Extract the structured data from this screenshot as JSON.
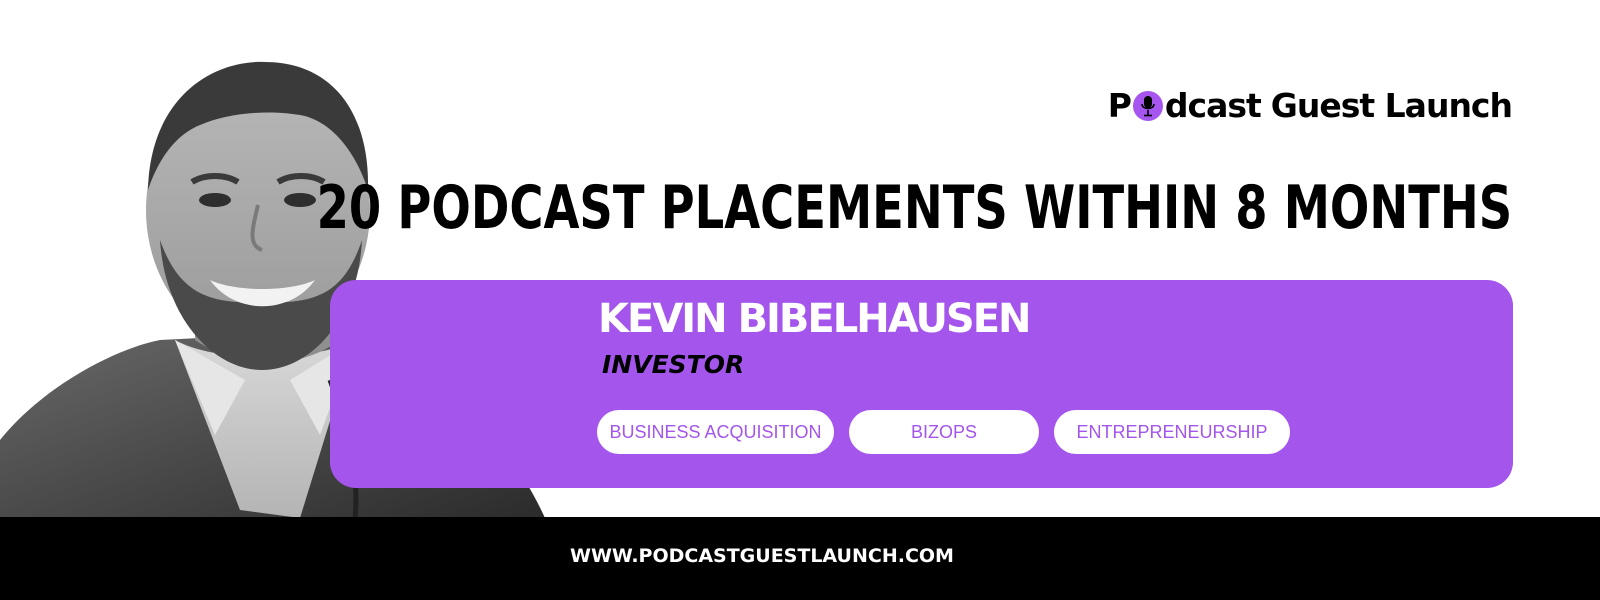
{
  "brand": {
    "logo_letter_p": "P",
    "logo_after_mic": "dcast",
    "logo_second_word": "Guest Launch",
    "accent_color": "#a455ec"
  },
  "headline": "20 PODCAST PLACEMENTS WITHIN 8 MONTHS",
  "guest": {
    "name": "KEVIN BIBELHAUSEN",
    "role": "INVESTOR"
  },
  "tags": [
    "BUSINESS ACQUISITION",
    "BIZOPS",
    "ENTREPRENEURSHIP"
  ],
  "footer": {
    "url": "WWW.PODCASTGUESTLAUNCH.COM"
  },
  "icons": {
    "logo_mic": "microphone-icon"
  }
}
